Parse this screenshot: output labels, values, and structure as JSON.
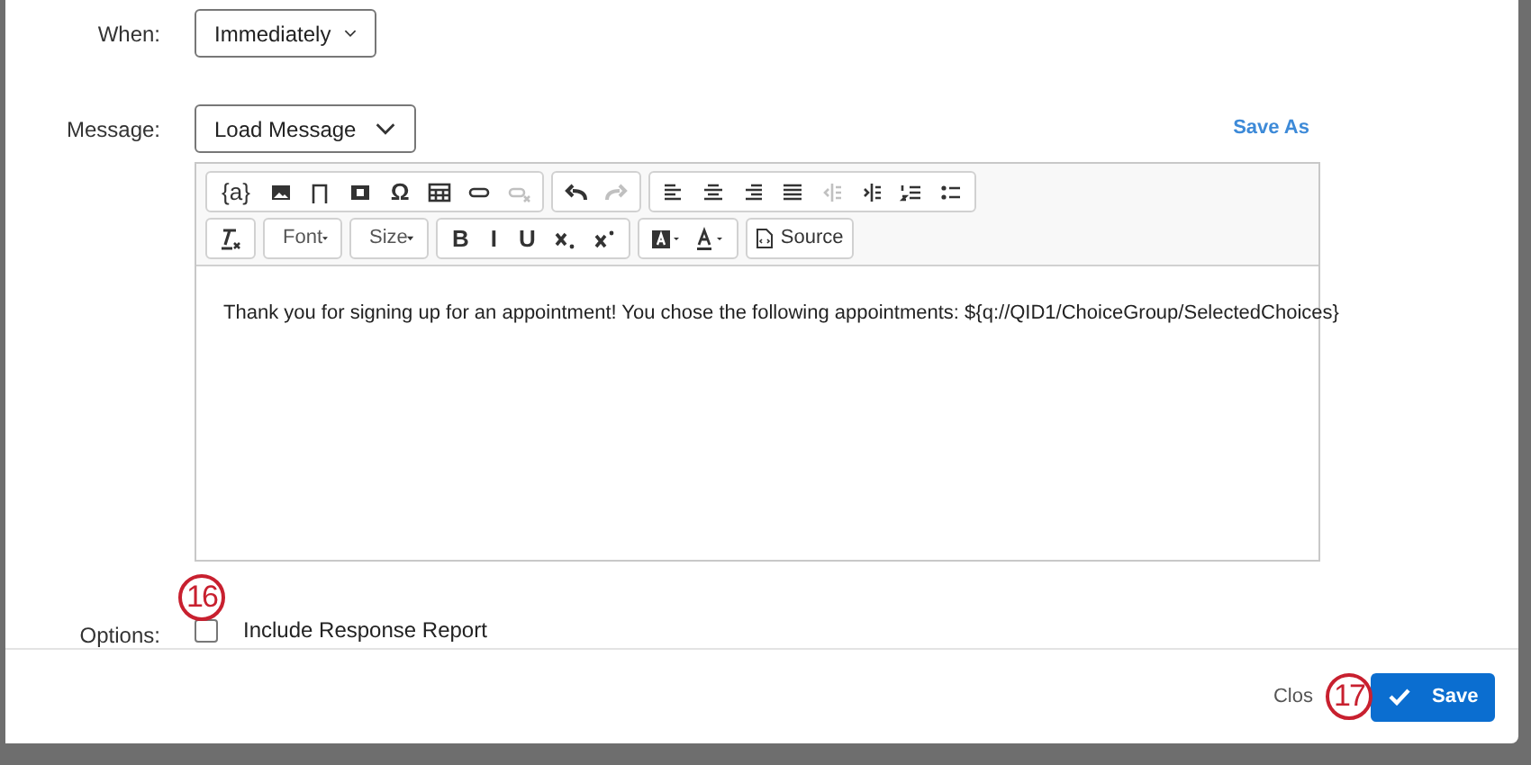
{
  "when": {
    "label": "When:",
    "value": "Immediately"
  },
  "message": {
    "label": "Message:",
    "value": "Load Message",
    "save_as": "Save As"
  },
  "toolbar": {
    "rows": [
      [
        [
          {
            "kind": "text",
            "label": "{a}"
          },
          {
            "kind": "icon",
            "disabled": false
          },
          {
            "kind": "icon",
            "disabled": false
          },
          {
            "kind": "icon",
            "disabled": false
          },
          {
            "kind": "text",
            "label": "Ω"
          },
          {
            "kind": "icon",
            "disabled": false
          },
          {
            "kind": "icon",
            "disabled": false
          },
          {
            "kind": "icon",
            "disabled": true
          }
        ],
        [
          {
            "kind": "icon",
            "disabled": false
          },
          {
            "kind": "icon",
            "disabled": true
          }
        ],
        [
          {
            "kind": "icon",
            "disabled": false
          },
          {
            "kind": "icon",
            "disabled": false
          },
          {
            "kind": "icon",
            "disabled": false
          },
          {
            "kind": "icon",
            "disabled": false
          },
          {
            "kind": "icon",
            "disabled": true
          },
          {
            "kind": "icon",
            "disabled": false
          },
          {
            "kind": "icon",
            "disabled": false
          },
          {
            "kind": "icon",
            "disabled": false
          }
        ]
      ],
      [
        [
          {
            "kind": "icon",
            "disabled": false
          }
        ],
        [
          {
            "kind": "dropdown",
            "label": "Font"
          }
        ],
        [
          {
            "kind": "dropdown",
            "label": "Size"
          }
        ],
        [
          {
            "kind": "text",
            "label": "B"
          },
          {
            "kind": "text",
            "label": "I"
          },
          {
            "kind": "text",
            "label": "U"
          },
          {
            "kind": "icon",
            "disabled": false
          },
          {
            "kind": "icon",
            "disabled": false
          }
        ],
        [
          {
            "kind": "icon",
            "disabled": false
          },
          {
            "kind": "icon",
            "disabled": false
          }
        ],
        [
          {
            "kind": "source",
            "label": "Source"
          }
        ]
      ]
    ]
  },
  "body": "Thank you for signing up for an appointment! You chose the following appointments: ${q://QID1/ChoiceGroup/SelectedChoices}",
  "options": {
    "label": "Options:",
    "items": [
      {
        "label": "Include Response Report",
        "checked": false
      }
    ]
  },
  "footer": {
    "close": "Clos",
    "save": "Save"
  },
  "callouts": [
    {
      "label": "16"
    },
    {
      "label": "17"
    }
  ]
}
